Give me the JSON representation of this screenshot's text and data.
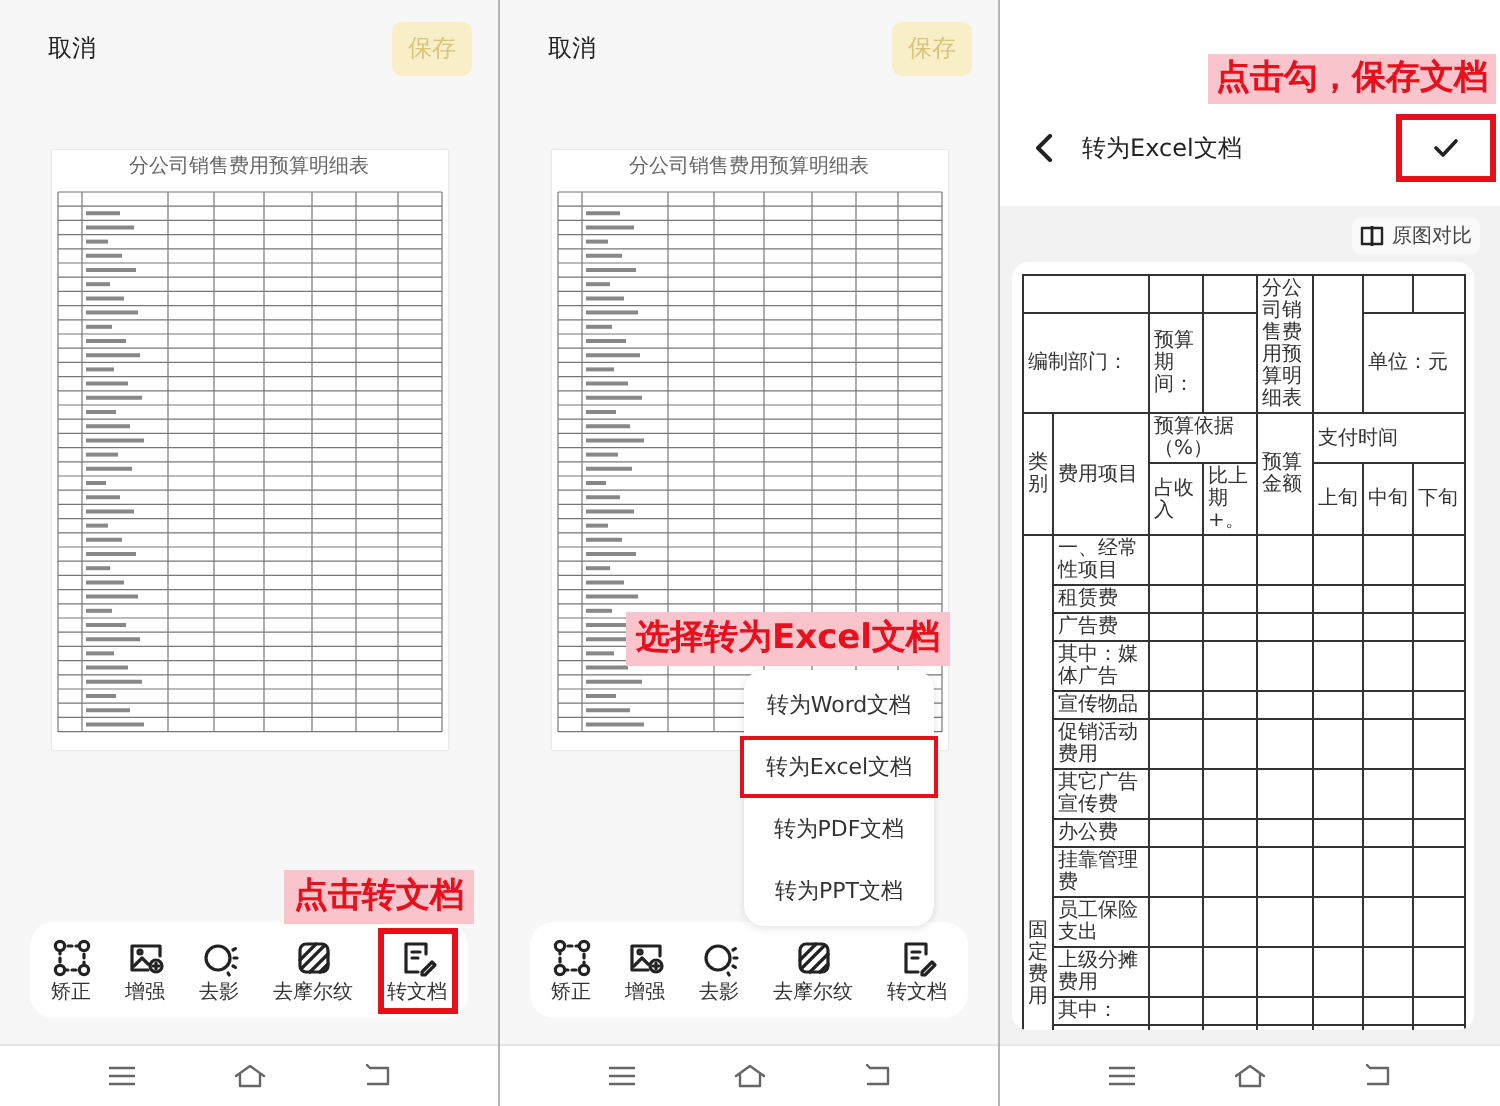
{
  "panels": [
    {
      "kind": "editor",
      "cancel": "取消",
      "save": {
        "label": "保存",
        "disabled": true
      },
      "document_title": "分公司销售费用预算明细表",
      "toolbar": [
        {
          "label": "矫正",
          "highlighted": false
        },
        {
          "label": "增强",
          "highlighted": false
        },
        {
          "label": "去影",
          "highlighted": false
        },
        {
          "label": "去摩尔纹",
          "highlighted": false
        },
        {
          "label": "转文档",
          "highlighted": true
        }
      ],
      "callout": "点击转文档"
    },
    {
      "kind": "editor",
      "cancel": "取消",
      "save": {
        "label": "保存",
        "disabled": true
      },
      "document_title": "分公司销售费用预算明细表",
      "toolbar": [
        {
          "label": "矫正",
          "highlighted": false
        },
        {
          "label": "增强",
          "highlighted": false
        },
        {
          "label": "去影",
          "highlighted": false
        },
        {
          "label": "去摩尔纹",
          "highlighted": false
        },
        {
          "label": "转文档",
          "highlighted": false
        }
      ],
      "menu": [
        {
          "label": "转为Word文档",
          "highlighted": false
        },
        {
          "label": "转为Excel文档",
          "highlighted": true
        },
        {
          "label": "转为PDF文档",
          "highlighted": false
        },
        {
          "label": "转为PPT文档",
          "highlighted": false
        }
      ],
      "callout": "选择转为Excel文档"
    },
    {
      "kind": "result",
      "title": "转为Excel文档",
      "confirm_highlighted": true,
      "callout": "点击勾，保存文档",
      "compare": "原图对比",
      "table": {
        "title": "分公司销售费用预算明细表",
        "department": "编制部门：",
        "period": "预算期间：",
        "unit": "单位：元",
        "category": "类别",
        "item": "费用项目",
        "basis": "预算依据（%）",
        "amount": "预算金额",
        "pay_time": "支付时间",
        "share": "占收入",
        "prev": "比上期+。",
        "periods": [
          "上旬",
          "中旬",
          "下旬"
        ],
        "group": "固定费用",
        "rows": [
          "一、经常性项目",
          "租赁费",
          "广告费",
          "其中：媒体广告",
          "宣传物品",
          "促销活动费用",
          "其它广告宣传费",
          "办公费",
          "挂靠管理费",
          "员工保险支出",
          "上级分摊费用",
          "其中："
        ]
      }
    }
  ]
}
